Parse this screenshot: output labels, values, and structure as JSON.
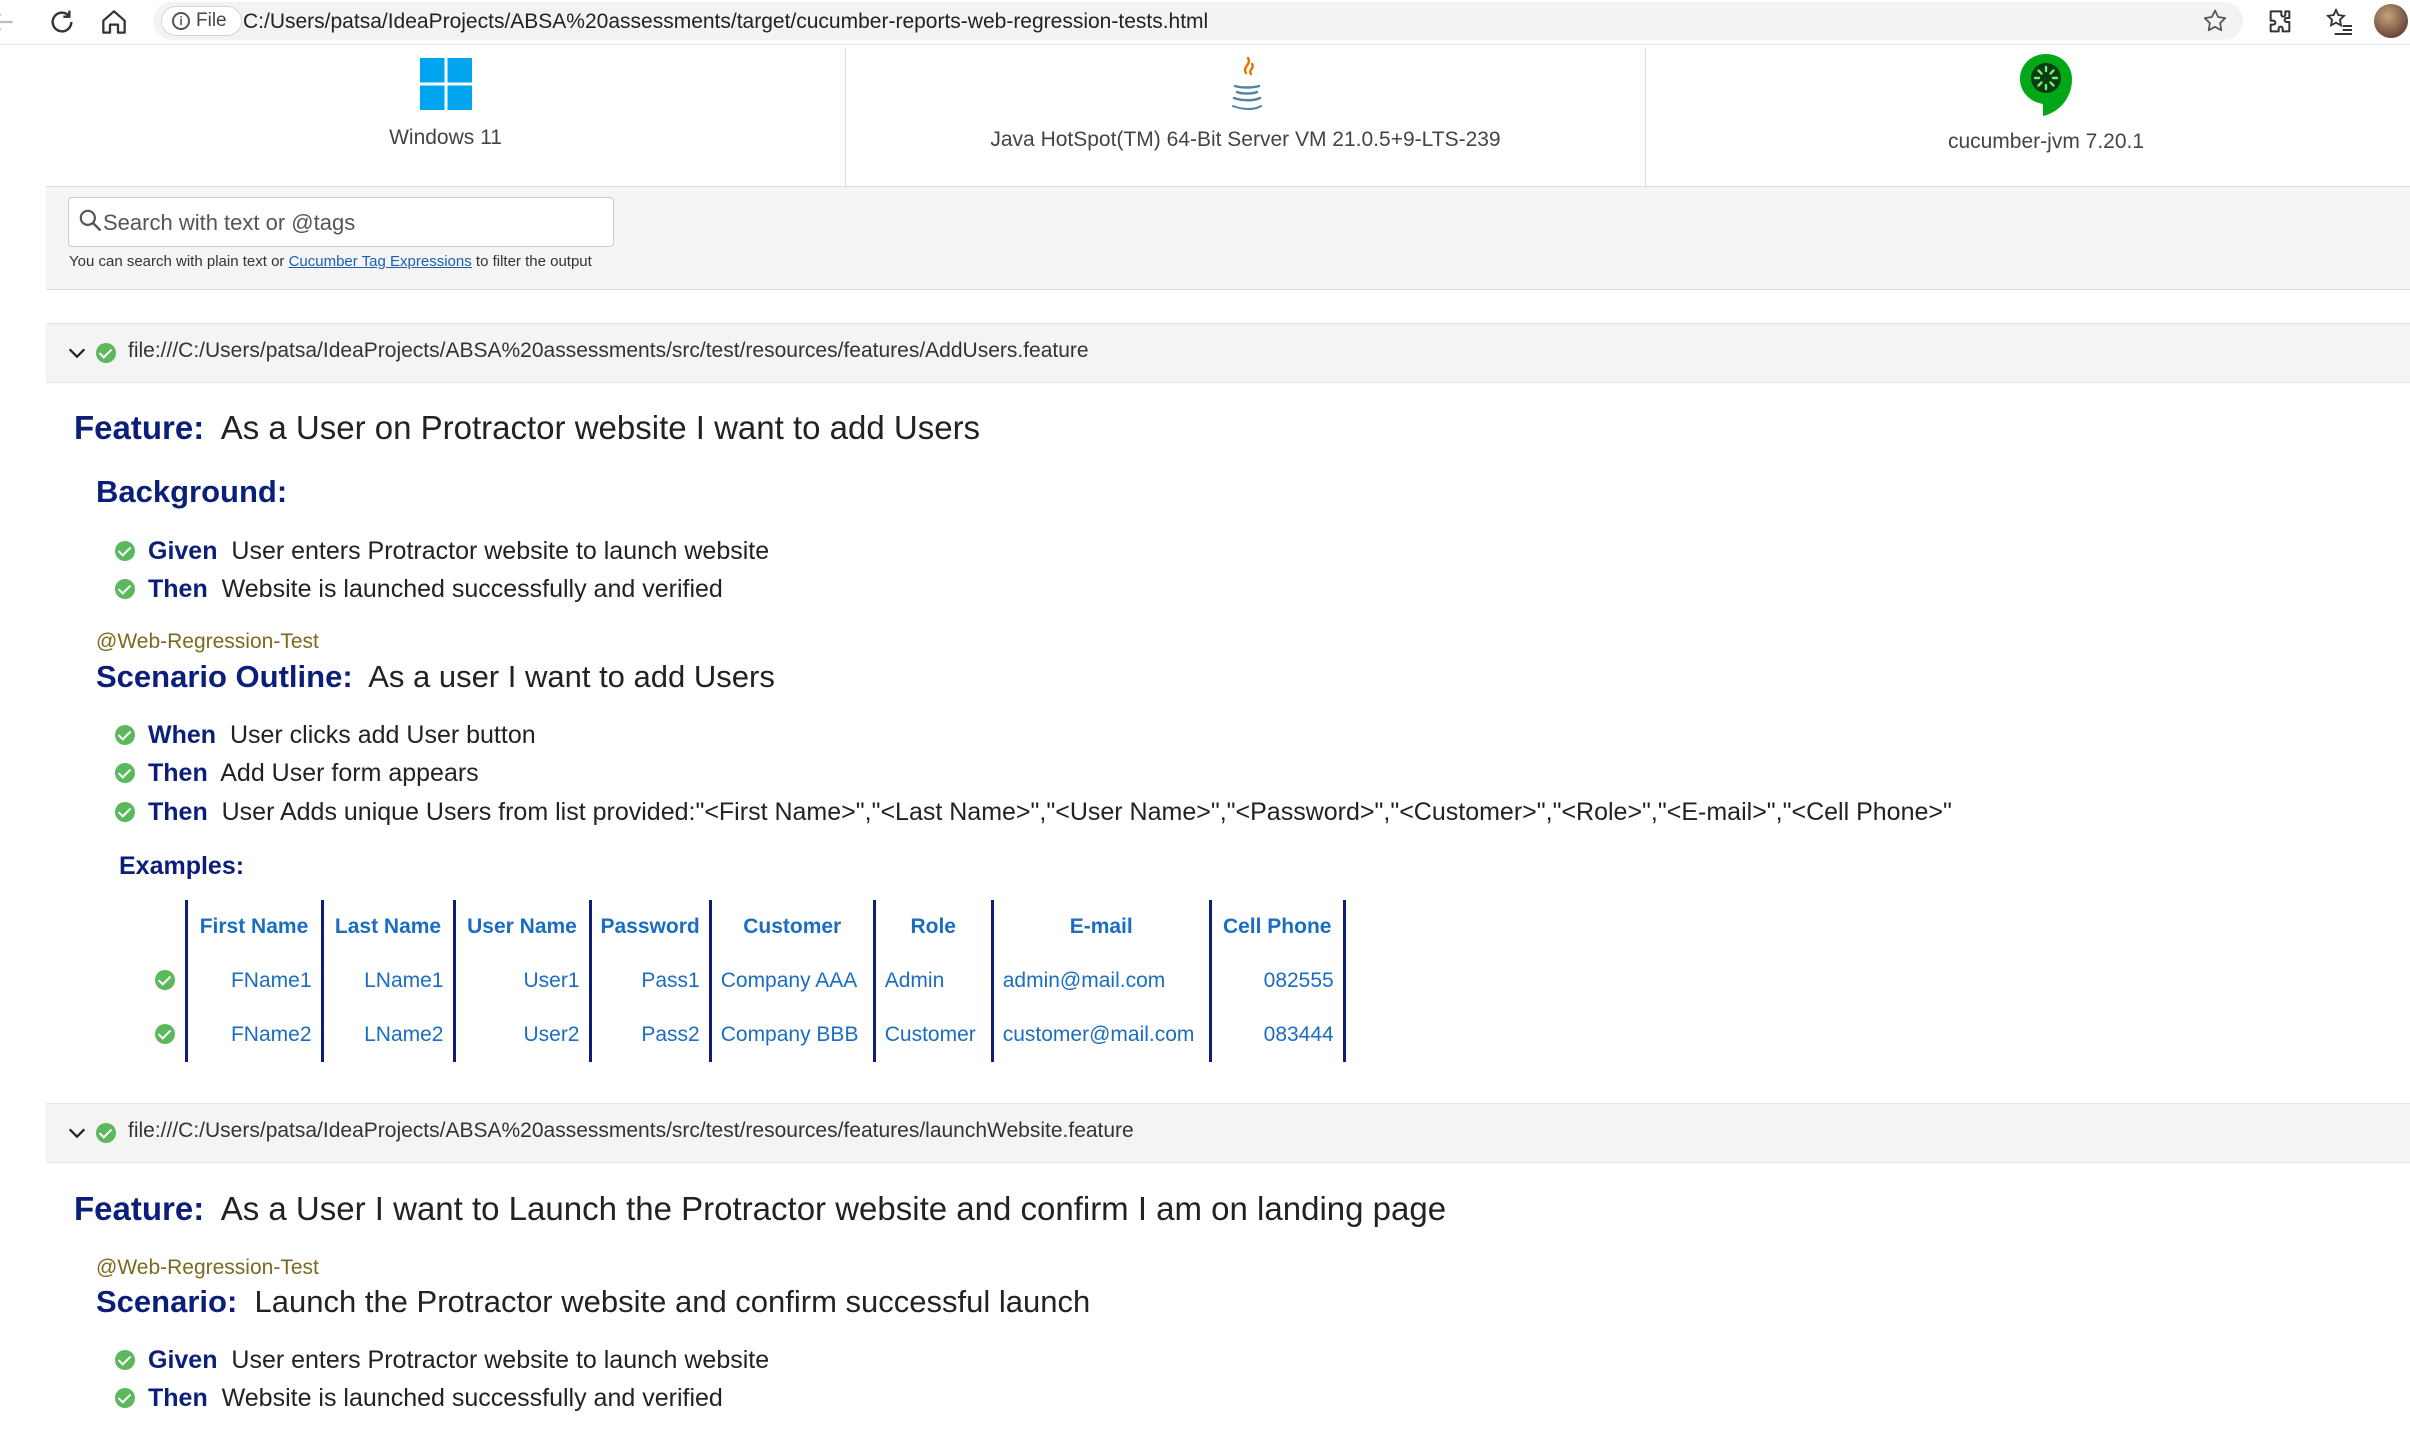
{
  "browser": {
    "file_chip": "File",
    "url": "C:/Users/patsa/IdeaProjects/ABSA%20assessments/target/cucumber-reports-web-regression-tests.html"
  },
  "env": {
    "os": "Windows 11",
    "runtime": "Java HotSpot(TM) 64-Bit Server VM 21.0.5+9-LTS-239",
    "implementation": "cucumber-jvm 7.20.1"
  },
  "search": {
    "placeholder": "Search with text or @tags",
    "hint_prefix": "You can search with plain text or",
    "hint_link": "Cucumber Tag Expressions",
    "hint_suffix": "to filter the output"
  },
  "features": [
    {
      "path": "file:///C:/Users/patsa/IdeaProjects/ABSA%20assessments/src/test/resources/features/AddUsers.feature",
      "keyword": "Feature:",
      "name": "As a User on Protractor website I want to add Users",
      "background": {
        "keyword": "Background:",
        "steps": [
          {
            "keyword": "Given",
            "text": "User enters Protractor website to launch website"
          },
          {
            "keyword": "Then",
            "text": "Website is launched successfully and verified"
          }
        ]
      },
      "scenario": {
        "tag": "@Web-Regression-Test",
        "keyword": "Scenario Outline:",
        "name": "As a user I want to add Users",
        "steps": [
          {
            "keyword": "When",
            "text": "User clicks add User button"
          },
          {
            "keyword": "Then",
            "text": "Add User form appears"
          },
          {
            "keyword": "Then",
            "text": "User Adds unique Users from list provided:\"<First Name>\",\"<Last Name>\",\"<User Name>\",\"<Password>\",\"<Customer>\",\"<Role>\",\"<E-mail>\",\"<Cell Phone>\""
          }
        ],
        "examples": {
          "keyword": "Examples:",
          "headers": [
            "First Name",
            "Last Name",
            "User Name",
            "Password",
            "Customer",
            "Role",
            "E-mail",
            "Cell Phone"
          ],
          "rows": [
            [
              "FName1",
              "LName1",
              "User1",
              "Pass1",
              "Company AAA",
              "Admin",
              "admin@mail.com",
              "082555"
            ],
            [
              "FName2",
              "LName2",
              "User2",
              "Pass2",
              "Company BBB",
              "Customer",
              "customer@mail.com",
              "083444"
            ]
          ]
        }
      }
    },
    {
      "path": "file:///C:/Users/patsa/IdeaProjects/ABSA%20assessments/src/test/resources/features/launchWebsite.feature",
      "keyword": "Feature:",
      "name": "As a User I want to Launch the Protractor website and confirm I am on landing page",
      "scenario": {
        "tag": "@Web-Regression-Test",
        "keyword": "Scenario:",
        "name": "Launch the Protractor website and confirm successful launch",
        "steps": [
          {
            "keyword": "Given",
            "text": "User enters Protractor website to launch website"
          },
          {
            "keyword": "Then",
            "text": "Website is launched successfully and verified"
          }
        ]
      }
    }
  ],
  "icons": {
    "status_passed": "check-circle-icon",
    "expand": "chevron-down-icon",
    "search": "search-icon"
  },
  "colors": {
    "passed": "#5cb85c",
    "keyword": "#0b1f7a",
    "table_text": "#1a6dc2",
    "tag": "#7a6a1f",
    "windows_logo": "#00a4ef",
    "cucumber_logo": "#00a818"
  }
}
